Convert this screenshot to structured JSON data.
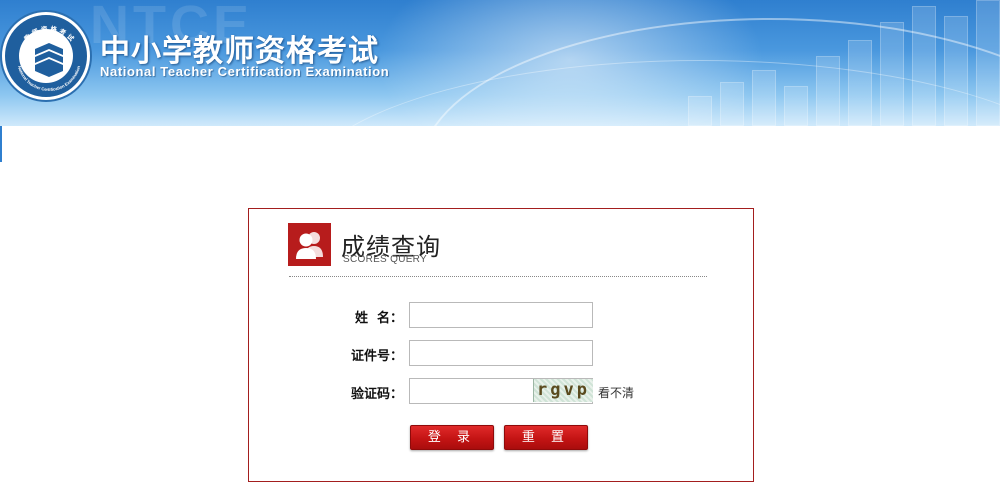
{
  "header": {
    "title": "中小学教师资格考试",
    "subtitle": "National Teacher Certification Examination",
    "logo_text_top": "教 师 资 格 考 试",
    "logo_text_bottom": "National Teacher Certification Examination",
    "faint_watermark": "NTCE"
  },
  "panel": {
    "title": "成绩查询",
    "subtitle": "SCORES QUERY",
    "icon": "users-icon"
  },
  "form": {
    "name_label": "姓  名：",
    "name_value": "",
    "id_label": "证件号：",
    "id_value": "",
    "captcha_label": "验证码：",
    "captcha_value": "",
    "captcha_text": "rgvp",
    "captcha_refresh": "看不清"
  },
  "buttons": {
    "login": "登 录",
    "reset": "重 置"
  },
  "colors": {
    "brand_blue": "#2f7fcf",
    "accent_red": "#b71c1c",
    "panel_border": "#a31e1e"
  }
}
